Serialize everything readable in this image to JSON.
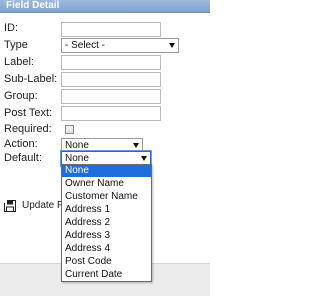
{
  "panel": {
    "title": "Field Detail"
  },
  "form": {
    "id_label": "ID:",
    "type_label": "Type",
    "type_value": "- Select -",
    "label_label": "Label:",
    "sublabel_label": "Sub-Label:",
    "group_label": "Group:",
    "posttext_label": "Post Text:",
    "required_label": "Required:",
    "action_label": "Action:",
    "action_value": "None",
    "default_label": "Default:",
    "default_value": "None"
  },
  "default_dropdown": {
    "options": [
      "None",
      "Owner Name",
      "Customer Name",
      "Address 1",
      "Address 2",
      "Address 3",
      "Address 4",
      "Post Code",
      "Current Date"
    ],
    "selected": "None"
  },
  "update_button": {
    "label": "Update Fi",
    "icon": "save-icon"
  },
  "colors": {
    "header_bg": "#8fb0d8",
    "selection_bg": "#1e6fd9",
    "focus_border": "#2a66c4"
  }
}
